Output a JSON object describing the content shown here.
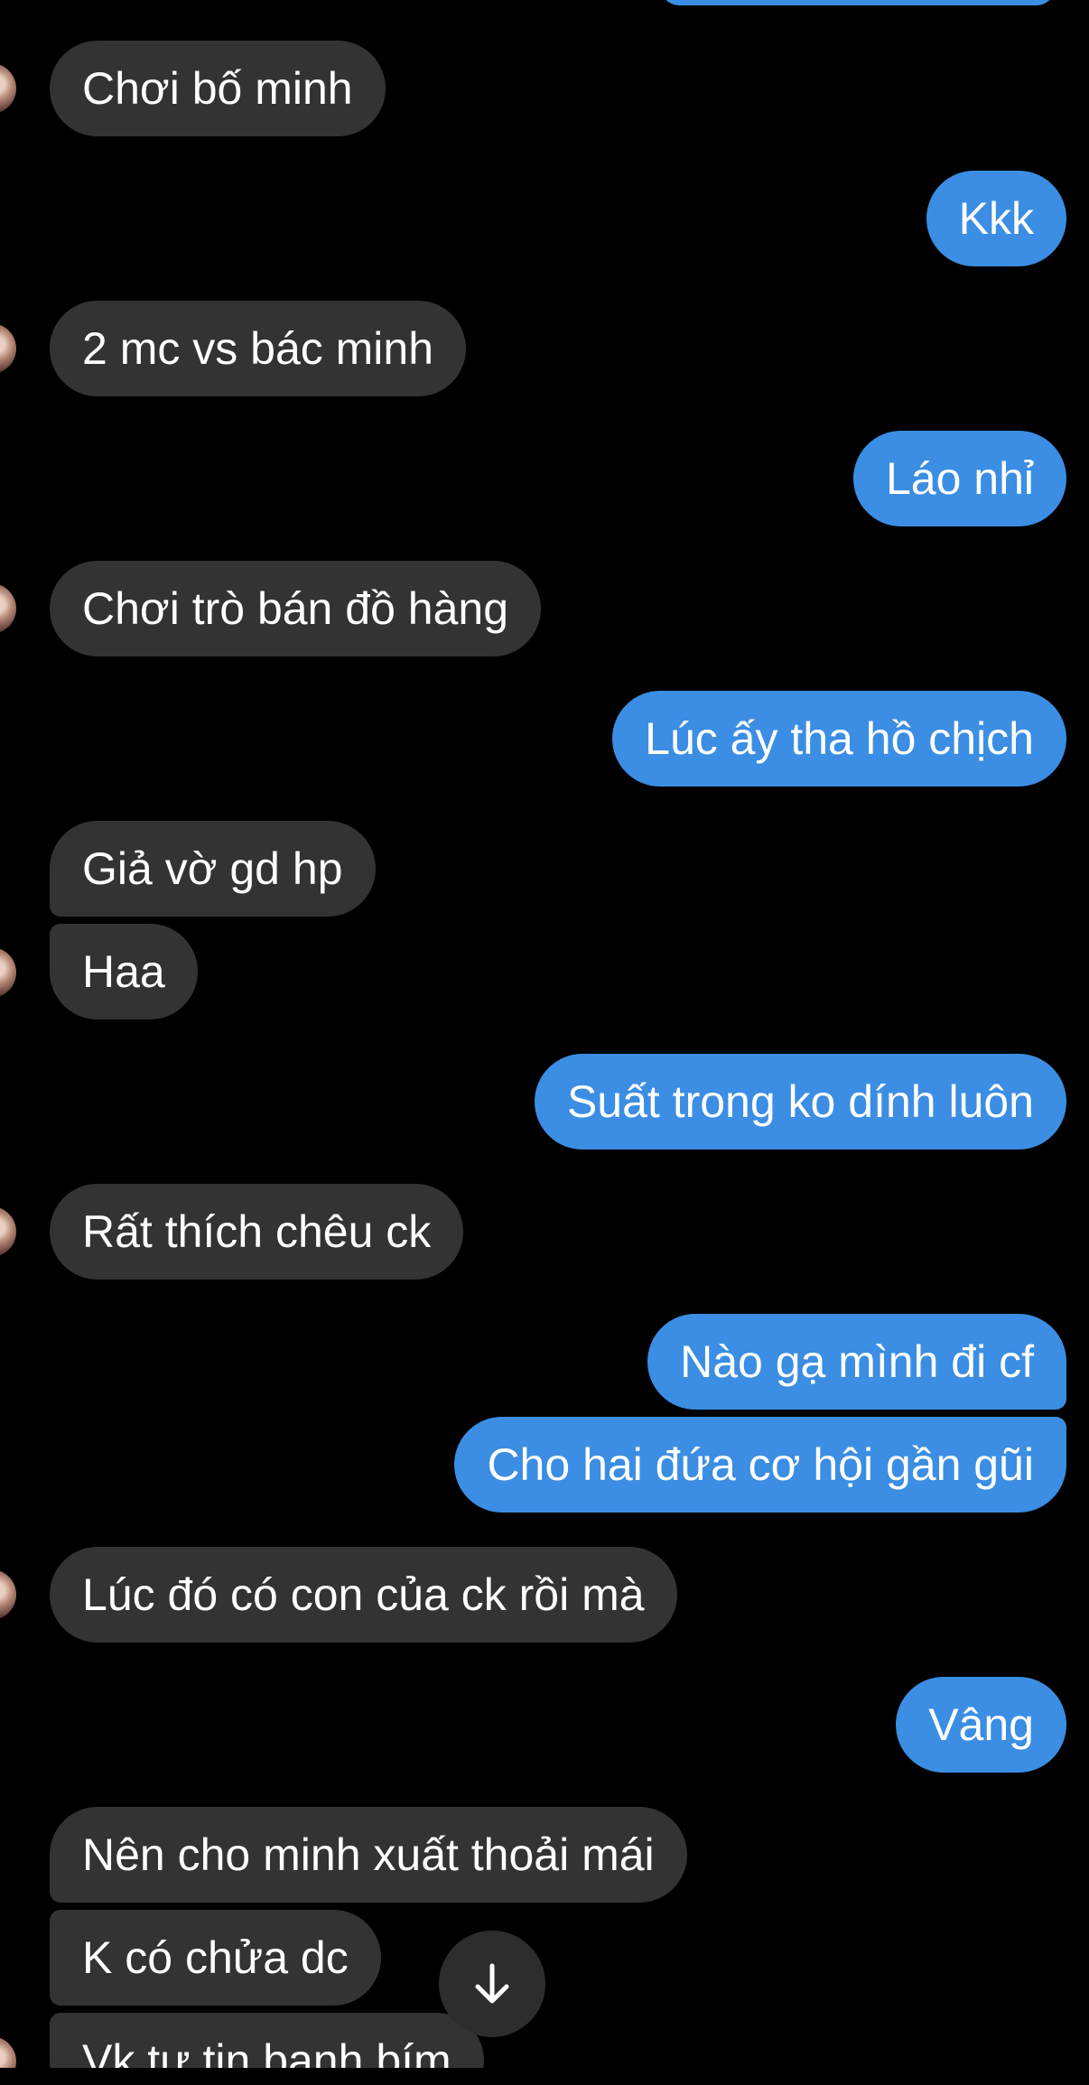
{
  "messages": [
    {
      "dir": "in",
      "text": "Chơi bố minh"
    },
    {
      "dir": "out",
      "text": "Kkk"
    },
    {
      "dir": "in",
      "text": "2 mc vs bác minh"
    },
    {
      "dir": "out",
      "text": "Láo nhỉ"
    },
    {
      "dir": "in",
      "text": "Chơi trò bán đồ hàng"
    },
    {
      "dir": "out",
      "text": "Lúc ấy tha hồ chịch"
    },
    {
      "dir": "in",
      "text": "Giả vờ gd hp"
    },
    {
      "dir": "in",
      "text": "Haa"
    },
    {
      "dir": "out",
      "text": "Suất trong ko dính luôn"
    },
    {
      "dir": "in",
      "text": "Rất thích chêu ck"
    },
    {
      "dir": "out",
      "text": "Nào gạ mình đi cf"
    },
    {
      "dir": "out",
      "text": "Cho hai đứa cơ hội gần gũi"
    },
    {
      "dir": "in",
      "text": "Lúc đó có con của ck rồi mà"
    },
    {
      "dir": "out",
      "text": "Vâng"
    },
    {
      "dir": "in",
      "text": "Nên cho minh xuất thoải mái"
    },
    {
      "dir": "in",
      "text": "K có chửa dc"
    },
    {
      "dir": "in",
      "text": "Vk tự tin banh bím"
    }
  ],
  "icons": {
    "scroll_down": "arrow-down-icon",
    "avatar": "contact-avatar"
  },
  "colors": {
    "background": "#000000",
    "incoming_bubble": "#333333",
    "outgoing_bubble": "#3b8ee3",
    "text": "#ffffff"
  }
}
